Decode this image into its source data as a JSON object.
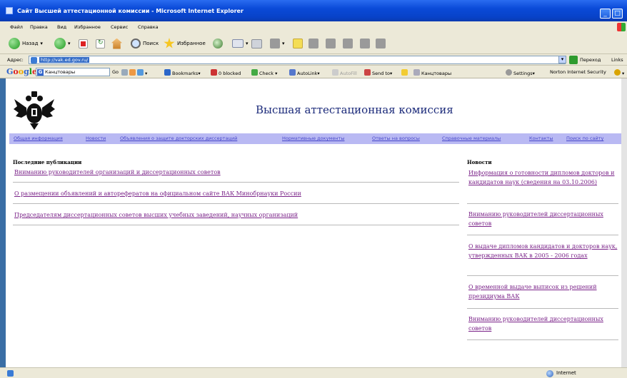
{
  "window": {
    "title": "Сайт Высшей аттестационной комиссии - Microsoft Internet Explorer"
  },
  "menu": [
    "Файл",
    "Правка",
    "Вид",
    "Избранное",
    "Сервис",
    "Справка"
  ],
  "toolbar": {
    "back_label": "Назад",
    "search_label": "Поиск",
    "favorites_label": "Избранное"
  },
  "address": {
    "label": "Адрес:",
    "url": "http://vak.ed.gov.ru/",
    "go_label": "Переход",
    "links_label": "Links"
  },
  "google": {
    "search_value": "Канцтовары",
    "go": "Go",
    "bookmarks": "Bookmarks",
    "blocked": "0 blocked",
    "check": "Check",
    "autolink": "AutoLink",
    "autofill": "AutoFill",
    "sendto": "Send to",
    "query_chip": "Канцтовары",
    "settings": "Settings",
    "norton": "Norton Internet Security"
  },
  "page": {
    "title": "Высшая аттестационная комиссия",
    "nav": [
      "Общая информация",
      "Новости",
      "Объявления о защите докторских диссертаций",
      "Нормативные документы",
      "Ответы на вопросы",
      "Справочные материалы",
      "Контакты",
      "Поиск по сайту"
    ],
    "publications_heading": "Последние публикации",
    "publications": [
      "Вниманию руководителей организаций и диссертационных советов",
      "О размещении объявлений и авторефератов на официальном сайте ВАК Минобрнауки России",
      "Председателям диссертационных советов высших учебных заведений, научных организаций"
    ],
    "news_heading": "Новости",
    "news": [
      "Информация о готовности дипломов докторов и кандидатов наук (сведения на 03.10.2006)",
      "Вниманию руководителей диссертационных советов",
      "О выдаче дипломов кандидатов и докторов наук, утвержденных ВАК в 2005 - 2006 годах",
      "О временной выдаче выписок из решений президиума ВАК",
      "Вниманию руководителей диссертационных советов"
    ]
  },
  "status": {
    "zone": "Internet"
  },
  "colors": {
    "titlebar": "#0a4ad8",
    "chrome": "#ece9d8",
    "navbar": "#b9b9f3",
    "nav_link": "#4747c9",
    "visited_link": "#7a2288",
    "site_title": "#1b2a7a"
  }
}
